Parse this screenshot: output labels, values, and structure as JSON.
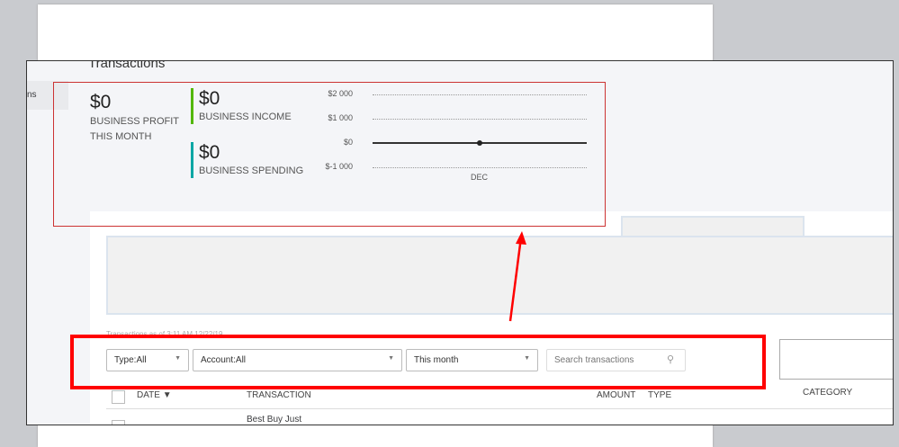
{
  "app": {
    "page_title": "Transactions",
    "sidebar_item": "ns"
  },
  "summary": {
    "profit": {
      "value": "$0",
      "label_line1": "BUSINESS PROFIT",
      "label_line2": "THIS MONTH"
    },
    "income": {
      "value": "$0",
      "label": "BUSINESS INCOME",
      "color": "#53b700"
    },
    "spending": {
      "value": "$0",
      "label": "BUSINESS SPENDING",
      "color": "#00a6a4"
    }
  },
  "chart_data": {
    "type": "line",
    "categories": [
      "DEC"
    ],
    "values": [
      0
    ],
    "yticks": [
      "$2 000",
      "$1 000",
      "$0",
      "$-1 000"
    ],
    "ylim": [
      -1000,
      2000
    ],
    "grid": true
  },
  "meta": {
    "partial_text": "Transactions as of 3:11 AM 12/22/19"
  },
  "filters": {
    "type": "Type:All",
    "account": "Account:All",
    "period": "This month",
    "search_placeholder": "Search transactions"
  },
  "table": {
    "headers": [
      "DATE ▼",
      "TRANSACTION",
      "AMOUNT",
      "TYPE",
      "CATEGORY"
    ],
    "rows": [
      {
        "transaction": "Best Buy Just"
      }
    ]
  },
  "colors": {
    "annotation": "#ff0000"
  }
}
